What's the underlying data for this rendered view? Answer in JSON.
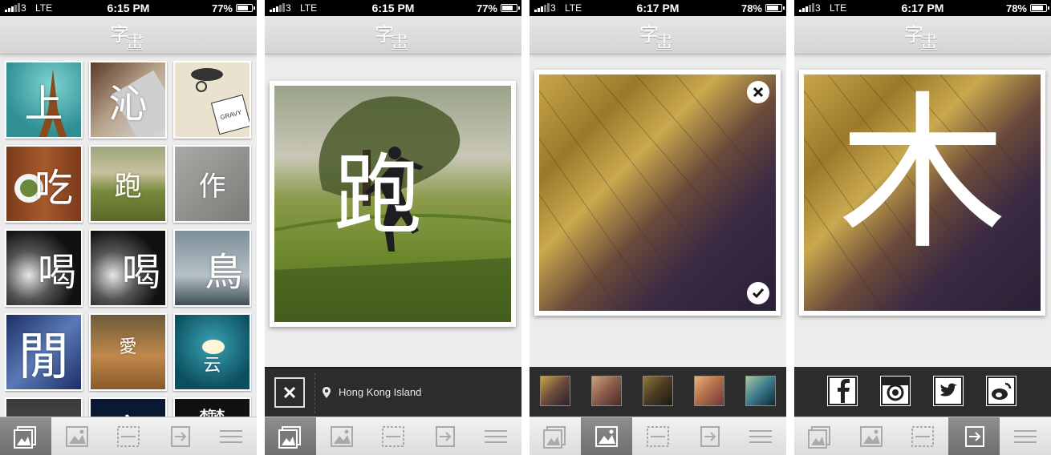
{
  "screens": [
    {
      "status": {
        "carrier": "3",
        "network": "LTE",
        "time": "6:15 PM",
        "battery": "77%"
      },
      "battery_level": 0.77
    },
    {
      "status": {
        "carrier": "3",
        "network": "LTE",
        "time": "6:15 PM",
        "battery": "77%"
      },
      "battery_level": 0.77
    },
    {
      "status": {
        "carrier": "3",
        "network": "LTE",
        "time": "6:17 PM",
        "battery": "78%"
      },
      "battery_level": 0.78
    },
    {
      "status": {
        "carrier": "3",
        "network": "LTE",
        "time": "6:17 PM",
        "battery": "78%"
      },
      "battery_level": 0.78
    }
  ],
  "app_logo": {
    "char1": "字",
    "char2": "畫"
  },
  "gallery": {
    "tiles": [
      {
        "char": "上",
        "name": "eiffel"
      },
      {
        "char": "沁",
        "name": "keyboard"
      },
      {
        "char": "",
        "name": "gravy-mug"
      },
      {
        "char": "吃",
        "name": "salad"
      },
      {
        "char": "跑",
        "name": "park-jump"
      },
      {
        "char": "作",
        "name": "concrete"
      },
      {
        "char": "喝",
        "name": "coffee-1"
      },
      {
        "char": "喝",
        "name": "coffee-2"
      },
      {
        "char": "鳥",
        "name": "birds"
      },
      {
        "char": "閒",
        "name": "window"
      },
      {
        "char": "愛",
        "name": "autumn-couple"
      },
      {
        "char": "云",
        "name": "cloud"
      },
      {
        "char": "",
        "name": "row5-a"
      },
      {
        "char": "字",
        "name": "row5-b"
      },
      {
        "char": "鬱",
        "name": "row5-c"
      }
    ]
  },
  "screen2": {
    "overlay_char": "跑",
    "location": "Hong Kong Island"
  },
  "screen4": {
    "overlay_char": "木"
  },
  "tabbar_icons": [
    "gallery-icon",
    "photo-icon",
    "edit-icon",
    "export-icon",
    "menu-icon"
  ],
  "active_tabs": [
    0,
    0,
    1,
    3
  ],
  "share_icons": [
    "facebook-icon",
    "instagram-icon",
    "twitter-icon",
    "weibo-icon"
  ],
  "colors": {
    "dark_bar": "#2c2c2c",
    "tab_active": "#7a7a7a"
  }
}
